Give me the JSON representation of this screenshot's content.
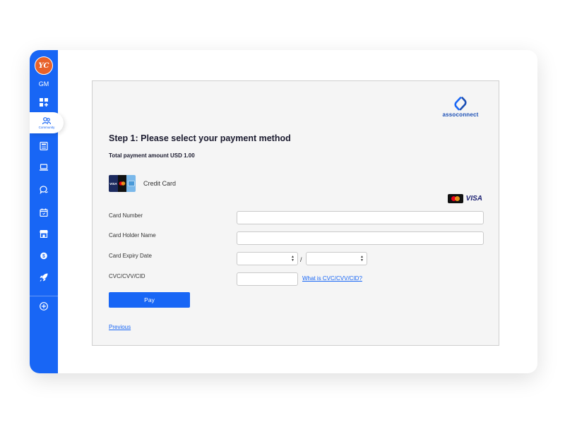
{
  "sidebar": {
    "avatar_initials": "YC",
    "org_code": "GM",
    "active_label": "Community",
    "items": [
      {
        "icon": "dashboard-icon"
      },
      {
        "icon": "community-icon",
        "label": "Community"
      },
      {
        "icon": "calculator-icon"
      },
      {
        "icon": "laptop-icon"
      },
      {
        "icon": "chat-icon"
      },
      {
        "icon": "calendar-icon"
      },
      {
        "icon": "store-icon"
      },
      {
        "icon": "piggy-bank-icon"
      },
      {
        "icon": "rocket-icon"
      },
      {
        "icon": "add-icon"
      }
    ]
  },
  "brand": {
    "name": "assoconnect",
    "color": "#1b4fb5"
  },
  "payment": {
    "title": "Step 1: Please select your payment method",
    "amount_text": "Total payment amount USD 1.00",
    "method_label": "Credit Card",
    "brand_visa": "VISA",
    "card_logo_visa": "VISA",
    "fields": {
      "card_number_label": "Card Number",
      "card_holder_label": "Card Holder Name",
      "expiry_label": "Card Expiry Date",
      "expiry_separator": "/",
      "cvc_label": "CVC/CVV/CID",
      "cvc_help_link": "What is CVC/CVV/CID?"
    },
    "pay_button": "Pay",
    "previous_link": "Previous"
  },
  "colors": {
    "accent": "#1866f5",
    "avatar": "#e8622a"
  }
}
